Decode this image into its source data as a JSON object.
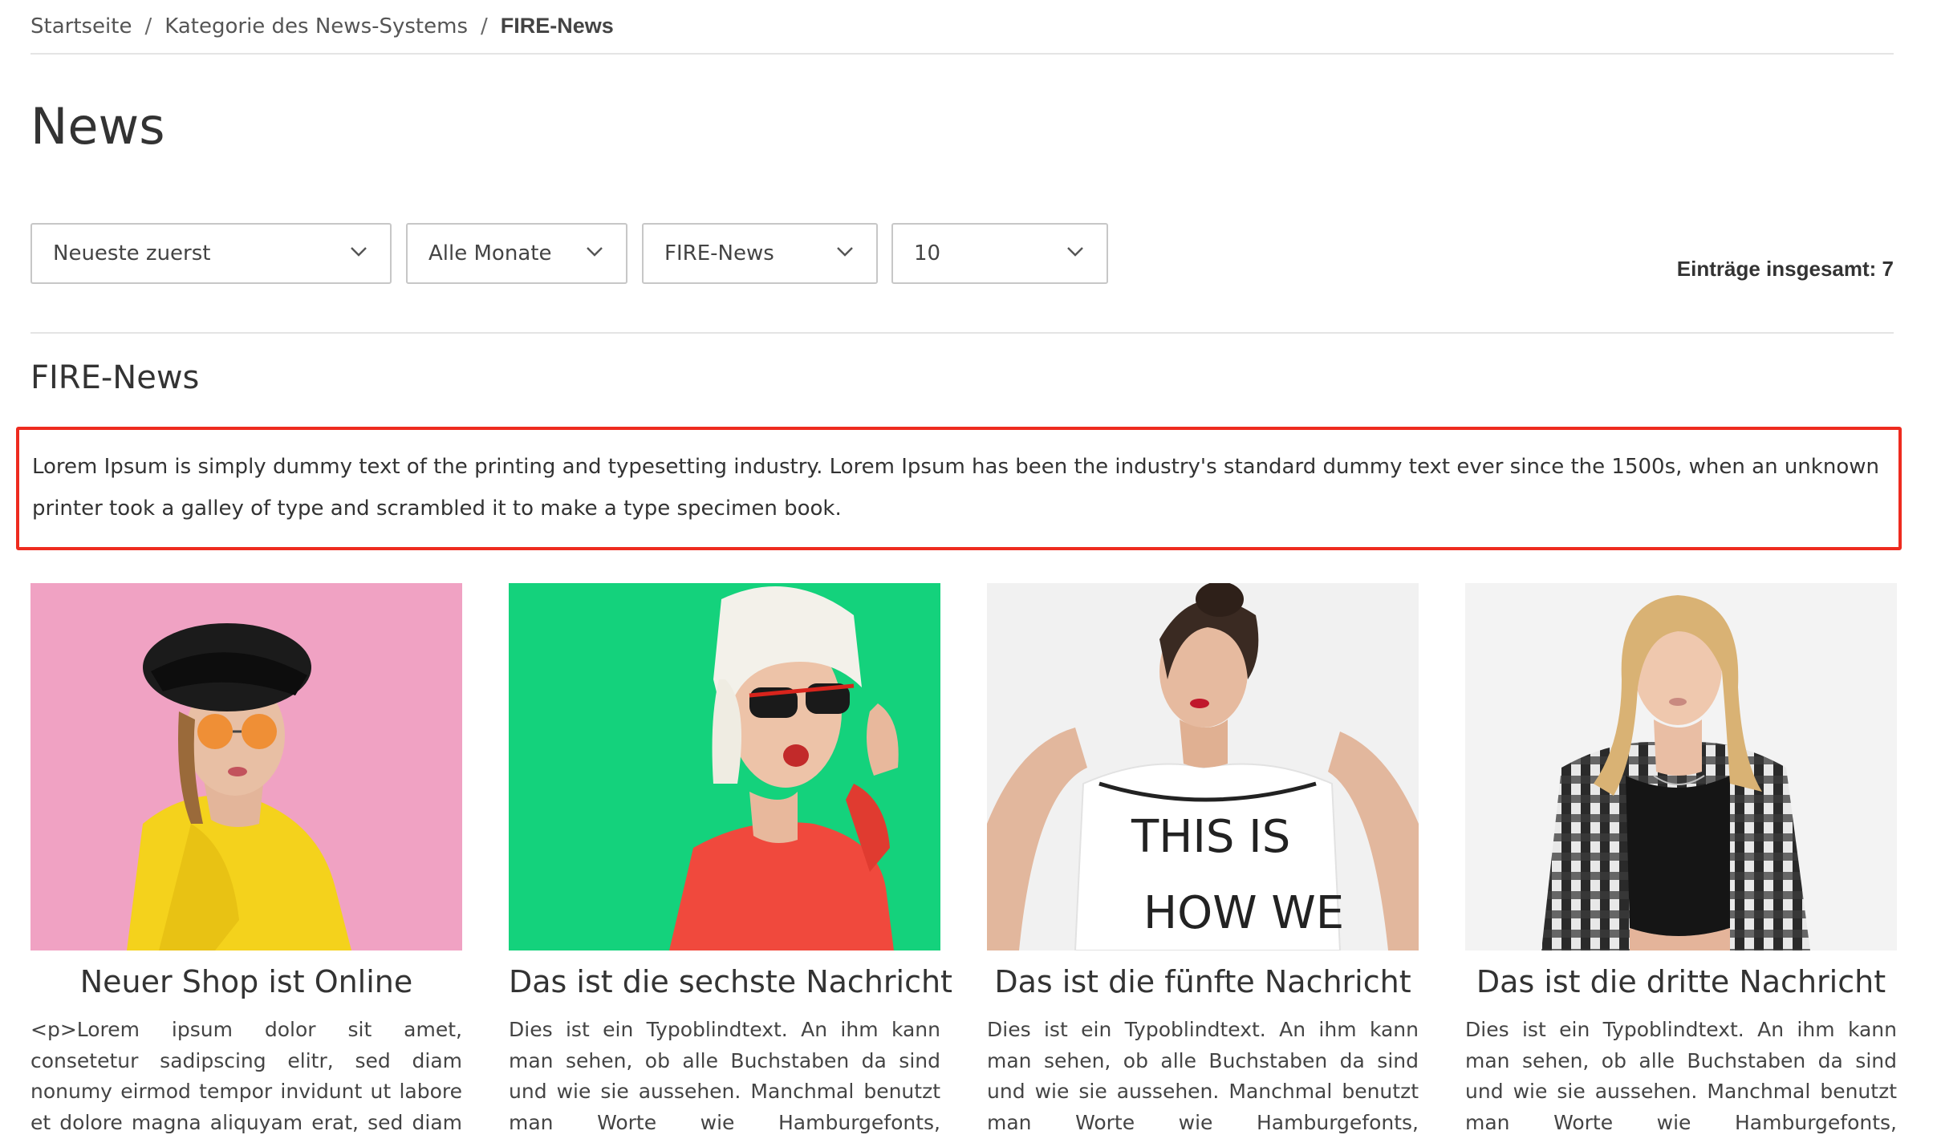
{
  "breadcrumb": {
    "home": "Startseite",
    "category": "Kategorie des News-Systems",
    "current": "FIRE-News",
    "separator": "/"
  },
  "page": {
    "title": "News"
  },
  "filters": {
    "sort": "Neueste zuerst",
    "month": "Alle Monate",
    "category": "FIRE-News",
    "per_page": "10"
  },
  "total_entries": "Einträge insgesamt: 7",
  "category": {
    "title": "FIRE-News",
    "description": "Lorem Ipsum is simply dummy text of the printing and typesetting industry. Lorem Ipsum has been the industry's standard dummy text ever since the 1500s, when an unknown printer took a galley of type and scrambled it to make a type specimen book."
  },
  "news": [
    {
      "title": "Neuer Shop ist Online",
      "excerpt": "<p>Lorem ipsum dolor sit amet, consetetur sadipscing elitr, sed diam nonumy eirmod tempor invidunt ut labore et dolore magna aliquyam erat, sed diam voluptua. At vero eos et accusam et justo duo dolores et ea rebum.",
      "image_bg": "#ee9ec0"
    },
    {
      "title": "Das ist die sechste Nachricht",
      "excerpt": "Dies ist ein Typoblindtext. An ihm kann man sehen, ob alle Buchstaben da sind und wie sie aussehen. Manchmal benutzt man Worte wie Hamburgefonts, Rafgenduks oder Handgloves, um Schriften zu testen.",
      "image_bg": "#14d27c"
    },
    {
      "title": "Das ist die fünfte Nachricht",
      "excerpt": "Dies ist ein Typoblindtext. An ihm kann man sehen, ob alle Buchstaben da sind und wie sie aussehen. Manchmal benutzt man Worte wie Hamburgefonts, Rafgenduks oder Handgloves, um Schriften zu testen.",
      "image_bg": "#f1f1f1",
      "shirt_text": [
        "THIS IS",
        "HOW WE"
      ]
    },
    {
      "title": "Das ist die dritte Nachricht",
      "excerpt": "Dies ist ein Typoblindtext. An ihm kann man sehen, ob alle Buchstaben da sind und wie sie aussehen. Manchmal benutzt man Worte wie Hamburgefonts, Rafgenduks oder Handgloves, um Schriften zu testen.",
      "image_bg": "#f3f3f3"
    }
  ],
  "colors": {
    "highlight_border": "#ee2b1f",
    "divider": "#e4e4e4",
    "text": "#333333"
  },
  "icons": {
    "select_arrow": "chevron-down-icon"
  }
}
